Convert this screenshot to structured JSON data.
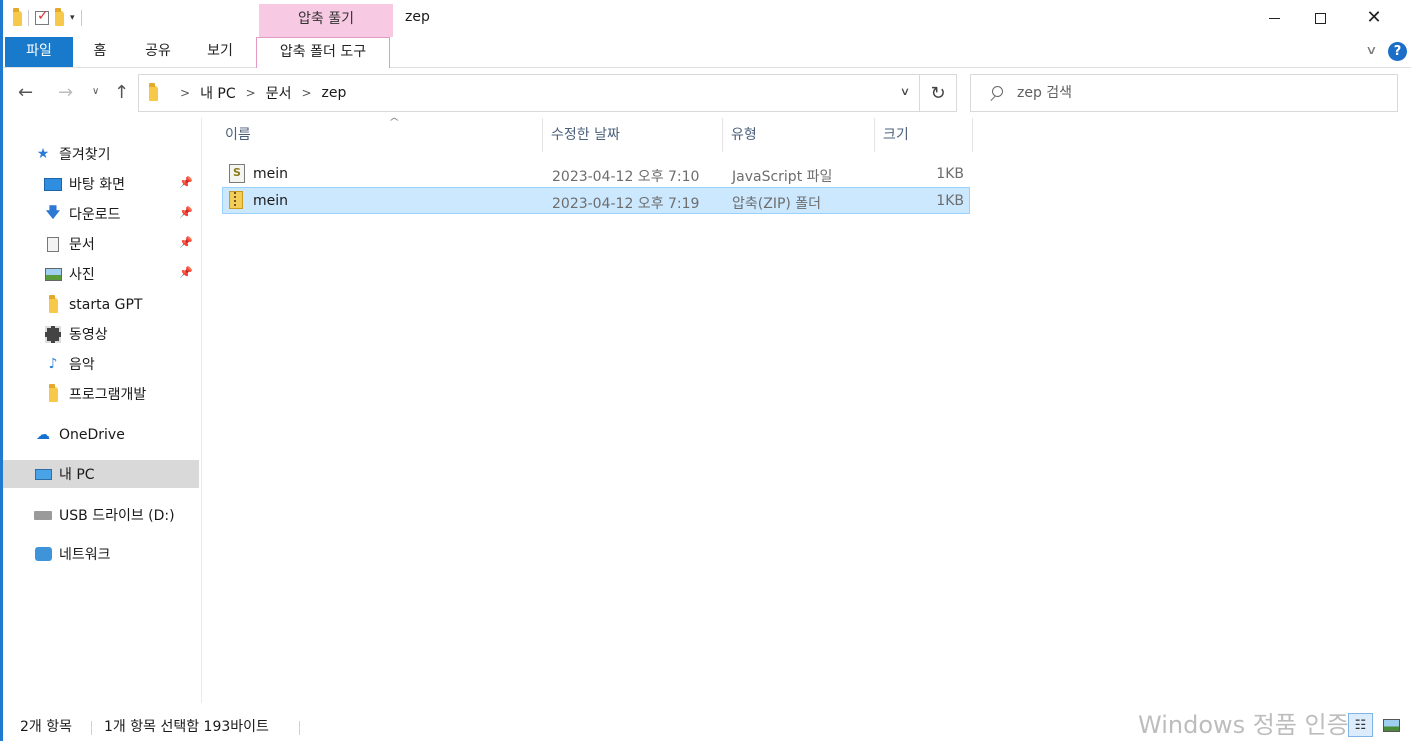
{
  "window": {
    "title": "zep",
    "tool_tab_header": "압축 풀기",
    "minimize_label": "",
    "maximize_label": "",
    "close_glyph": "✕"
  },
  "qat": {
    "dropdown_glyph": "▾"
  },
  "ribbon": {
    "tabs": [
      {
        "label": "파일",
        "active": true
      },
      {
        "label": "홈"
      },
      {
        "label": "공유"
      },
      {
        "label": "보기"
      },
      {
        "label": "압축 폴더 도구"
      }
    ],
    "expand_glyph": "∨",
    "help_glyph": "?"
  },
  "nav": {
    "back_glyph": "←",
    "forward_glyph": "→",
    "recent_glyph": "∨",
    "up_glyph": "↑",
    "refresh_glyph": "↻",
    "breadcrumb": [
      "내 PC",
      "문서",
      "zep"
    ],
    "separator_glyph": ">",
    "dropdown_glyph": "∨"
  },
  "search": {
    "placeholder": "zep 검색"
  },
  "navpane": {
    "favorites_label": "즐겨찾기",
    "favorites": [
      {
        "label": "바탕 화면",
        "icon": "desktop-icon",
        "pinned": true
      },
      {
        "label": "다운로드",
        "icon": "download-icon",
        "pinned": true
      },
      {
        "label": "문서",
        "icon": "document-icon",
        "pinned": true
      },
      {
        "label": "사진",
        "icon": "pictures-icon",
        "pinned": true
      },
      {
        "label": "starta GPT",
        "icon": "folder-icon",
        "pinned": false
      },
      {
        "label": "동영상",
        "icon": "videos-icon",
        "pinned": false
      },
      {
        "label": "음악",
        "icon": "music-icon",
        "pinned": false
      },
      {
        "label": "프로그램개발",
        "icon": "folder-icon",
        "pinned": false
      }
    ],
    "onedrive_label": "OneDrive",
    "thispc_label": "내 PC",
    "usb_label": "USB 드라이브 (D:)",
    "network_label": "네트워크",
    "pin_glyph": "📌",
    "star_glyph": "★",
    "download_glyph": "🡇",
    "music_glyph": "♪",
    "cloud_glyph": "☁"
  },
  "content": {
    "columns": {
      "name": "이름",
      "date": "수정한 날짜",
      "type": "유형",
      "size": "크기"
    },
    "sort_glyph": "^",
    "files": [
      {
        "name": "mein",
        "date": "2023-04-12 오후 7:10",
        "type": "JavaScript 파일",
        "size": "1KB",
        "icon": "js-file-icon",
        "selected": false
      },
      {
        "name": "mein",
        "date": "2023-04-12 오후 7:19",
        "type": "압축(ZIP) 폴더",
        "size": "1KB",
        "icon": "zip-folder-icon",
        "selected": true
      }
    ]
  },
  "status": {
    "item_count": "2개 항목",
    "selection": "1개 항목 선택함 193바이트",
    "watermark": "Windows 정품 인증",
    "details_glyph": "☷"
  },
  "colors": {
    "accent": "#1979ca",
    "tool_tab": "#f7c9e2",
    "selection_bg": "#cce8ff",
    "selection_border": "#99d1ff"
  }
}
